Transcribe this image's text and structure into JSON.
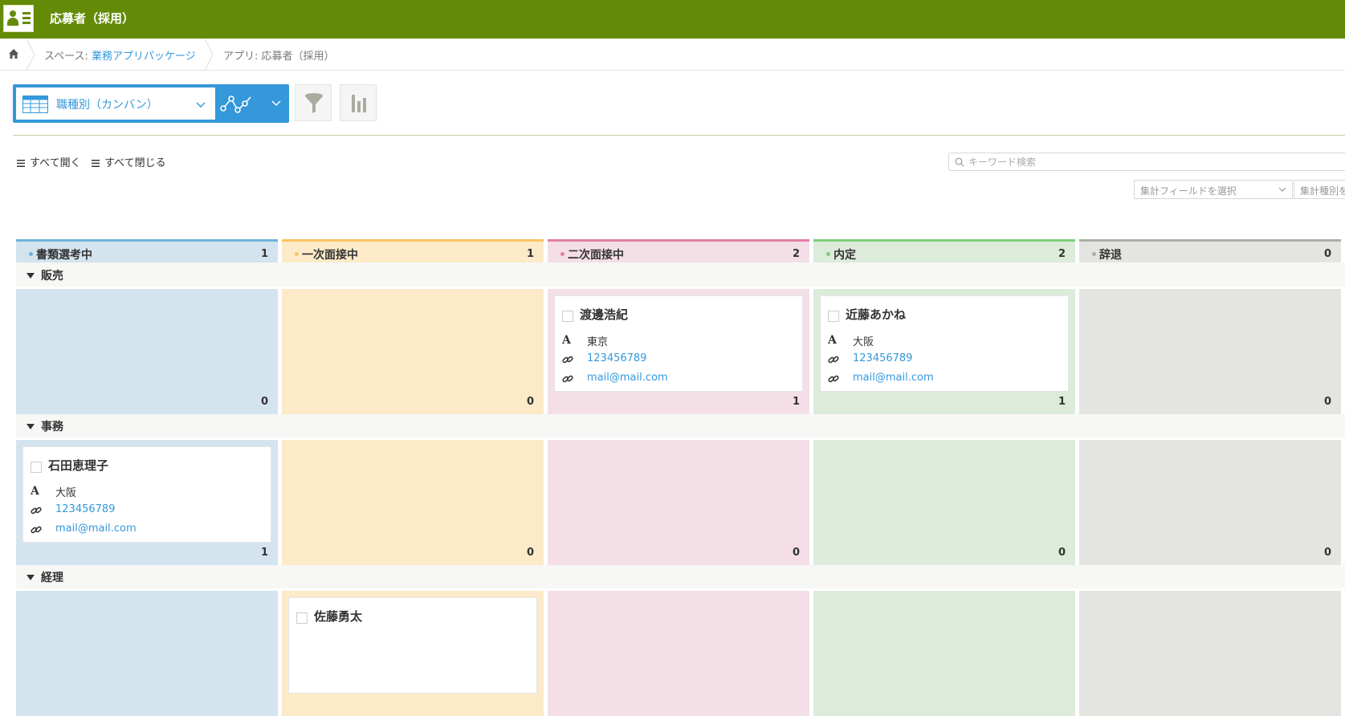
{
  "header": {
    "title": "応募者（採用）"
  },
  "breadcrumb": {
    "space_prefix": "スペース: ",
    "space_name": "業務アプリパッケージ",
    "app_prefix": "アプリ: ",
    "app_name": "応募者（採用）"
  },
  "toolbar": {
    "view_label": "職種別（カンバン）"
  },
  "controls": {
    "expand_all": "すべて開く",
    "collapse_all": "すべて閉じる",
    "search_placeholder": "キーワード検索",
    "agg_field": "集計フィールドを選択",
    "agg_type": "集計種別を"
  },
  "columns": [
    {
      "name": "書類選考中",
      "count": "1",
      "accent": "#6fb3d8",
      "bg": "#d4e4ef"
    },
    {
      "name": "一次面接中",
      "count": "1",
      "accent": "#f7c55e",
      "bg": "#fceac8"
    },
    {
      "name": "二次面接中",
      "count": "2",
      "accent": "#e47fa6",
      "bg": "#f4dfe7"
    },
    {
      "name": "内定",
      "count": "2",
      "accent": "#7ccf7c",
      "bg": "#dcebda"
    },
    {
      "name": "辞退",
      "count": "0",
      "accent": "#a8b0a4",
      "bg": "#e4e4e0"
    }
  ],
  "lanes": [
    {
      "name": "販売",
      "counts": [
        "0",
        "0",
        "1",
        "1",
        "0"
      ]
    },
    {
      "name": "事務",
      "counts": [
        "1",
        "0",
        "0",
        "0",
        "0"
      ]
    },
    {
      "name": "経理",
      "counts": [
        "",
        "",
        "",
        "",
        ""
      ]
    }
  ],
  "cards": {
    "watanabe": {
      "name": "渡邊浩紀",
      "place": "東京",
      "phone": "123456789",
      "email": "mail@mail.com"
    },
    "kondo": {
      "name": "近藤あかね",
      "place": "大阪",
      "phone": "123456789",
      "email": "mail@mail.com"
    },
    "ishida": {
      "name": "石田恵理子",
      "place": "大阪",
      "phone": "123456789",
      "email": "mail@mail.com"
    },
    "sato": {
      "name": "佐藤勇太"
    }
  }
}
